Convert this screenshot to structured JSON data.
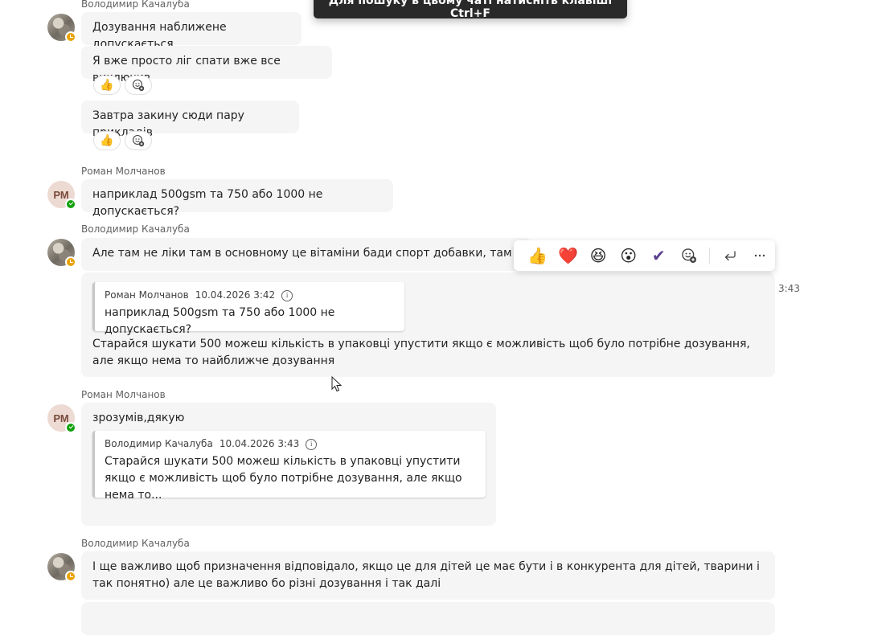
{
  "toast": {
    "text": "Для пошуку в цьому чаті натисніть клавіші Ctrl+F"
  },
  "messages": {
    "m1": {
      "sender": "Володимир Качалуба",
      "lines": [
        "Дозування наближене допускається",
        "Я вже просто ліг спати вже все виключив",
        "Завтра закину сюди пару прикладів"
      ]
    },
    "m2": {
      "sender": "Роман Молчанов",
      "initials": "РМ",
      "text": "наприклад 500gsm та 750 або 1000 не допускається?"
    },
    "m3": {
      "sender": "Володимир Качалуба",
      "text": "Але там не ліки там в основному це вітаміни бади спорт добавки, там не так",
      "time": "3:43",
      "quote": {
        "author": "Роман Молчанов",
        "date": "10.04.2026 3:42",
        "text": "наприклад 500gsm та 750 або 1000 не допускається?"
      },
      "reply_text": "Старайся шукати 500 можеш кількість в упаковці упустити якщо є можливість щоб було потрібне дозування, але якщо нема то найближче дозування"
    },
    "m4": {
      "sender": "Роман Молчанов",
      "initials": "РМ",
      "text": "зрозумів,дякую",
      "quote": {
        "author": "Володимир Качалуба",
        "date": "10.04.2026 3:43",
        "text": "Старайся шукати 500 можеш кількість в упаковці упустити якщо є можливість щоб було потрібне дозування, але якщо нема то..."
      }
    },
    "m5": {
      "sender": "Володимир Качалуба",
      "text": "І ще важливо щоб призначення відповідало, якщо це для дітей це має бути і в конкурента для дітей, тварини і так понятно) але це важливо бо різні дозування і так далі"
    }
  },
  "reactions": {
    "like": "👍",
    "add_reaction": "add-reaction-icon"
  },
  "toolbar": {
    "reactions": [
      "👍",
      "❤️",
      "😆",
      "😮",
      "✔"
    ],
    "icons": [
      "add-reaction-icon",
      "reply-icon",
      "more-options-icon"
    ],
    "more_label": "···",
    "reply_label": "↵"
  },
  "colors": {
    "status_away": "#eaa300",
    "status_available": "#13a10e",
    "bubble_bg": "#f5f5f5"
  }
}
